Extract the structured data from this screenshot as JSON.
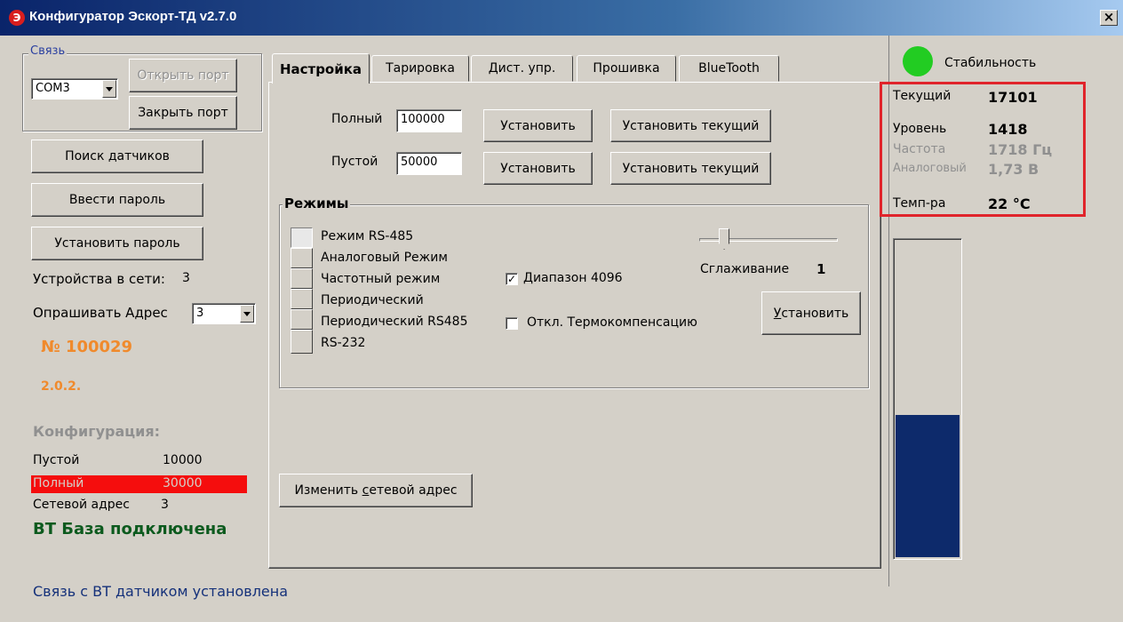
{
  "window": {
    "title": "Конфигуратор Эскорт-ТД v2.7.0",
    "icon_letter": "Э",
    "close_glyph": "×"
  },
  "connection": {
    "group_label": "Связь",
    "port_value": "COM3",
    "open_port": "Открыть порт",
    "close_port": "Закрыть порт"
  },
  "left": {
    "search_sensors": "Поиск датчиков",
    "enter_password": "Ввести пароль",
    "set_password": "Установить пароль",
    "devices_label": "Устройства в сети:",
    "devices_count": "3",
    "poll_address_label": "Опрашивать Адрес",
    "poll_address_value": "3",
    "serial_number": "№ 100029",
    "firmware": "2.0.2.",
    "config_title": "Конфигурация:",
    "config_empty_label": "Пустой",
    "config_empty_value": "10000",
    "config_full_label": "Полный",
    "config_full_value": "30000",
    "config_address_label": "Сетевой адрес",
    "config_address_value": "3",
    "bt_status": "ВТ База подключена"
  },
  "tabs": [
    {
      "label": "Настройка"
    },
    {
      "label": "Тарировка"
    },
    {
      "label": "Дист. упр."
    },
    {
      "label": "Прошивка"
    },
    {
      "label": "BlueTooth"
    }
  ],
  "settings": {
    "full_label": "Полный",
    "full_value": "100000",
    "empty_label": "Пустой",
    "empty_value": "50000",
    "set_button": "Установить",
    "set_current_button": "Установить текущий",
    "modes_title": "Режимы",
    "modes": [
      "Режим RS-485",
      "Аналоговый Режим",
      "Частотный режим",
      "Периодический",
      "Периодический RS485",
      "RS-232"
    ],
    "range_checkbox": "Диапазон 4096",
    "range_checked": "✓",
    "thermo_checkbox": "Откл. Термокомпенсацию",
    "smoothing_label": "Сглаживание",
    "smoothing_value": "1",
    "smoothing_level": 0.18,
    "apply_button_prefix": "",
    "apply_button_underline": "У",
    "apply_button_rest": "становить",
    "change_address_pre": "Изменить ",
    "change_address_underline": "с",
    "change_address_post": "етевой адрес"
  },
  "readings": {
    "stability_label": "Стабильность",
    "stability_color": "#22cc22",
    "current_label": "Текущий",
    "current_value": "17101",
    "level_label": "Уровень",
    "level_value": "1418",
    "frequency_label": "Частота",
    "frequency_value": "1718 Гц",
    "analog_label": "Аналоговый",
    "analog_value": "1,73 В",
    "temp_label": "Темп-ра",
    "temp_value": "22 °C",
    "fill_level": 0.45,
    "fill_color": "#0d2a6b"
  },
  "status_bar": {
    "text": "Связь с ВТ датчиком установлена"
  }
}
